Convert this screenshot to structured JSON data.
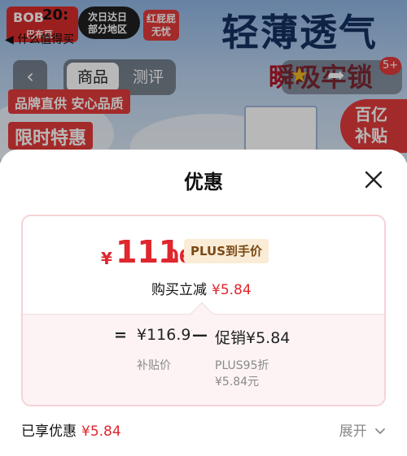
{
  "background_page": {
    "status_time": "20:",
    "back_hint": "◀ 什么值得买",
    "brand_tag": "BOB",
    "brand_tag_sub": "巴布豆",
    "delivery_pill": [
      "次日达日",
      "部分地区"
    ],
    "worry_tag": [
      "红屁屁",
      "无忧"
    ],
    "headline": "轻薄透气",
    "subline": "瞬吸牢锁",
    "tabs": {
      "active": "商品",
      "other": "测评"
    },
    "badge_count": "5+",
    "brand_promise": "品牌直供 安心品质",
    "flash_sale": "限时特惠",
    "subsidy": [
      "百亿",
      "补贴"
    ]
  },
  "sheet": {
    "title": "优惠",
    "final_price": {
      "symbol": "¥",
      "integer": "111",
      "decimal": ".06"
    },
    "plus_tag": "PLUS到手价",
    "direct_discount": {
      "label": "购买立减",
      "amount": "¥5.84"
    },
    "calc": {
      "equals": "=",
      "base_price": "¥116.9",
      "minus": "—",
      "promo": "促销¥5.84",
      "base_label": "补贴价",
      "plus_label": "PLUS95折",
      "plus_amount": "¥5.84元"
    },
    "enjoyed": {
      "label": "已享优惠",
      "amount": "¥5.84"
    },
    "expand_label": "展开"
  },
  "colors": {
    "accent_red": "#e0262e",
    "card_border": "#f5d3d6",
    "card_bottom_bg": "#fdf3f4",
    "plus_tag_bg": "#faecd6"
  }
}
